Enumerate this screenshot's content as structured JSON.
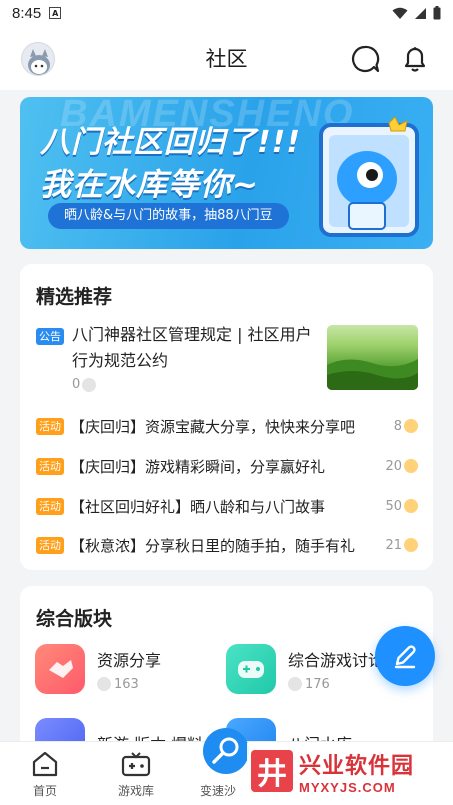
{
  "status_bar": {
    "time": "8:45",
    "a_label": "A"
  },
  "header": {
    "title": "社区"
  },
  "banner": {
    "bg_text": "BAMENSHENQ",
    "line1": "八门社区回归了!!!",
    "line2": "我在水库等你~",
    "pill": "晒八龄&与八门的故事，抽88八门豆"
  },
  "featured": {
    "title": "精选推荐",
    "notice": {
      "tag": "公告",
      "text": "八门神器社区管理规定 | 社区用户行为规范公约",
      "count": "0"
    },
    "items": [
      {
        "tag": "活动",
        "text": "【庆回归】资源宝藏大分享，快快来分享吧",
        "count": "8"
      },
      {
        "tag": "活动",
        "text": "【庆回归】游戏精彩瞬间，分享赢好礼",
        "count": "20"
      },
      {
        "tag": "活动",
        "text": "【社区回归好礼】晒八龄和与八门故事",
        "count": "50"
      },
      {
        "tag": "活动",
        "text": "【秋意浓】分享秋日里的随手拍，随手有礼",
        "count": "21"
      }
    ]
  },
  "sections": {
    "title": "综合版块",
    "items": [
      {
        "name": "资源分享",
        "count": "163",
        "color": "#ff6b6b"
      },
      {
        "name": "综合游戏讨论",
        "count": "176",
        "color": "#2ed3b7"
      },
      {
        "name": "新游·版本·爆料",
        "count": "",
        "color": "#5a73f5"
      },
      {
        "name": "八门水库",
        "count": "",
        "color": "#1e90ff"
      }
    ]
  },
  "tabbar": {
    "items": [
      {
        "label": "首页"
      },
      {
        "label": "游戏库"
      },
      {
        "label": "变速沙"
      }
    ]
  },
  "watermark": {
    "cn": "兴业软件园",
    "en": "MYXYJS.COM",
    "logo": "井"
  },
  "colors": {
    "accent": "#1e90ff",
    "tag_blue": "#2b8cf0",
    "tag_orange": "#ff9f1a"
  }
}
